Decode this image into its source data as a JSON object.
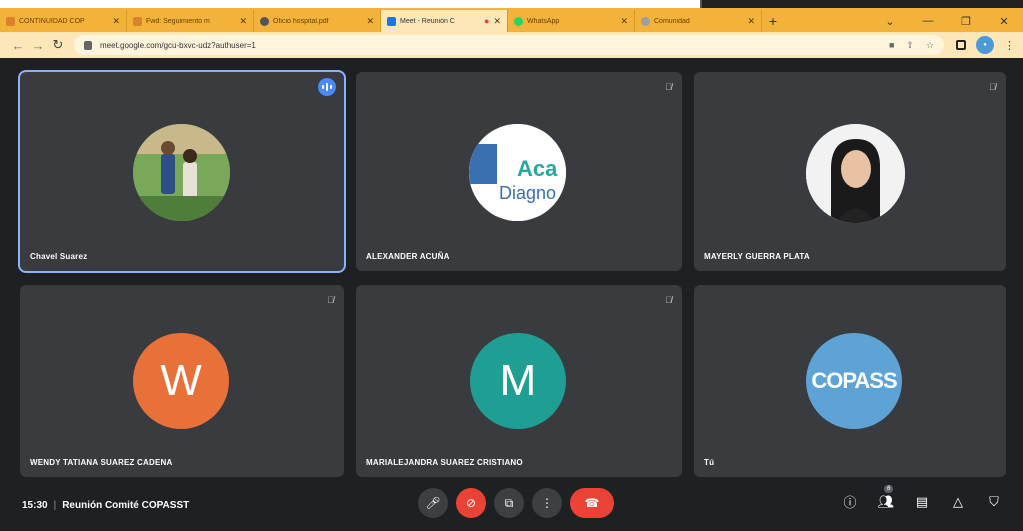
{
  "browser": {
    "tabs": [
      {
        "label": "CONTINUIDAD COP",
        "icon_color": "#d9832a",
        "active": false
      },
      {
        "label": "Fwd: Seguimiento m",
        "icon_color": "#d9832a",
        "active": false
      },
      {
        "label": "Oficio hospital.pdf",
        "icon_color": "#555555",
        "active": false
      },
      {
        "label": "Meet - Reunión C",
        "icon_color": "#1a73e8",
        "active": true
      },
      {
        "label": "WhatsApp",
        "icon_color": "#25d366",
        "active": false
      },
      {
        "label": "Comunidad",
        "icon_color": "#9aa0a6",
        "active": false
      }
    ],
    "new_tab_symbol": "+",
    "url": "meet.google.com/gcu-bxvc-udz?authuser=1"
  },
  "meet": {
    "participants": [
      {
        "name": "Chavel Suarez",
        "avatar_type": "photo-children",
        "speaking": true
      },
      {
        "name": "ALEXANDER ACUÑA",
        "avatar_type": "logo",
        "logo_text_1": "Aca",
        "logo_text_2": "Diagno"
      },
      {
        "name": "MAYERLY GUERRA PLATA",
        "avatar_type": "photo-woman"
      },
      {
        "name": "WENDY TATIANA SUAREZ CADENA",
        "initial": "W",
        "color": "#e8713a"
      },
      {
        "name": "MARIALEJANDRA SUAREZ CRISTIANO",
        "initial": "M",
        "color": "#1f9e94"
      },
      {
        "name": "Tú",
        "avatar_text": "COPASS",
        "color": "#5ea3d6"
      }
    ],
    "time": "15:30",
    "meeting_title": "Reunión Comité COPASST",
    "participant_count_badge": "6"
  }
}
